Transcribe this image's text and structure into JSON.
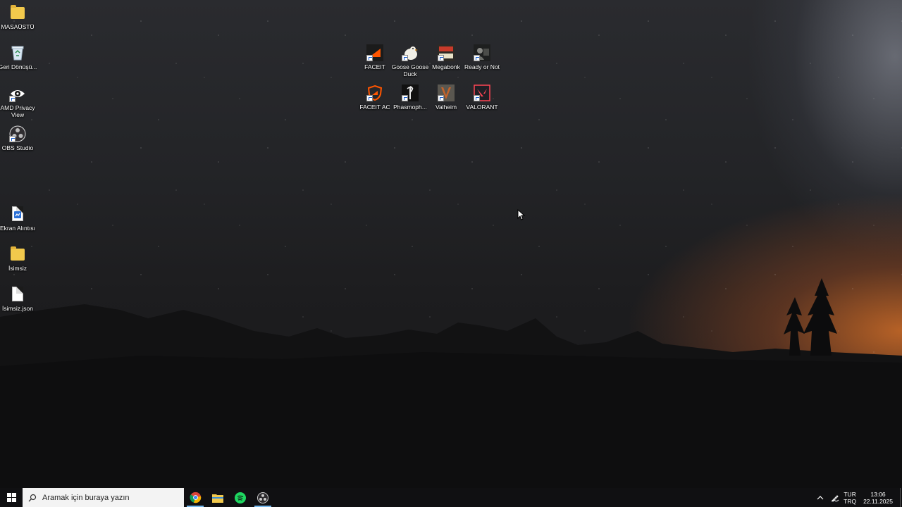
{
  "desktop_left_icons": [
    {
      "label": "MASAÜSTÜ",
      "icon": "folder-icon"
    },
    {
      "label": "Geri Dönüşü...",
      "icon": "recycle-bin-icon"
    },
    {
      "label": "AMD Privacy View",
      "icon": "amd-privacy-view-icon"
    },
    {
      "label": "OBS Studio",
      "icon": "obs-studio-icon"
    },
    {
      "label": "Ekran Alıntısı",
      "icon": "screenshot-file-icon"
    },
    {
      "label": "İsimsiz",
      "icon": "folder-icon"
    },
    {
      "label": "İsimsiz.json",
      "icon": "json-file-icon"
    }
  ],
  "desktop_game_icons": [
    {
      "label": "FACEIT",
      "icon": "faceit-icon"
    },
    {
      "label": "Goose Goose Duck",
      "icon": "goose-goose-duck-icon"
    },
    {
      "label": "Megabonk",
      "icon": "megabonk-icon"
    },
    {
      "label": "Ready or Not",
      "icon": "ready-or-not-icon"
    },
    {
      "label": "FACEIT AC",
      "icon": "faceit-ac-icon"
    },
    {
      "label": "Phasmoph...",
      "icon": "phasmophobia-icon"
    },
    {
      "label": "Valheim",
      "icon": "valheim-icon"
    },
    {
      "label": "VALORANT",
      "icon": "valorant-icon"
    }
  ],
  "taskbar": {
    "search_placeholder": "Aramak için buraya yazın",
    "apps": [
      "chrome-icon",
      "file-explorer-icon",
      "spotify-icon",
      "obs-studio-icon"
    ],
    "language_line1": "TUR",
    "language_line2": "TRQ",
    "time": "13:06",
    "date": "22.11.2025"
  }
}
